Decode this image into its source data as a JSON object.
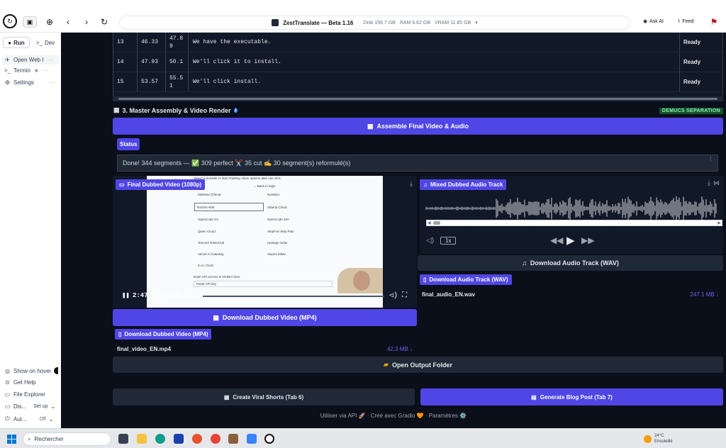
{
  "browser": {
    "title": "ZestTranslate — Beta 1.16",
    "disk": "Disk 156.7 GB",
    "ram": "RAM 5.62 GB",
    "vram": "VRAM 11.85 GB",
    "ask_ai": "Ask AI",
    "feed": "Feed"
  },
  "sidebar": {
    "tabs": [
      {
        "label": "Run"
      },
      {
        "label": "Dev"
      }
    ],
    "items": [
      {
        "label": "Open Web I"
      },
      {
        "label": "Termin"
      },
      {
        "label": "Settings"
      }
    ],
    "bottom": [
      {
        "label": "Show on hover"
      },
      {
        "label": "Get Help"
      },
      {
        "label": "File Explorer"
      },
      {
        "label": "Dis...",
        "value": "Set up"
      },
      {
        "label": "Aut...",
        "value": "Off"
      }
    ]
  },
  "segments": [
    {
      "id": "13",
      "start": "46.33",
      "end": "47.8\n9",
      "text": "We have the executable.",
      "status": "Ready"
    },
    {
      "id": "14",
      "start": "47.93",
      "end": "50.1",
      "text": "We'll click it to install.",
      "status": "Ready"
    },
    {
      "id": "15",
      "start": "53.57",
      "end": "55.5\n1",
      "text": "We'll click install.",
      "status": "Ready"
    }
  ],
  "section3": {
    "title": "3. Master Assembly & Video Render",
    "badge": "DEMUCS SEPARATION",
    "assemble_button": "Assemble Final Video & Audio",
    "status_label": "Status",
    "status_text": "Done! 344 segments — ✅ 309 perfect ✂️ 35 cut ✍️ 30 segment(s) reformulé(s)"
  },
  "video": {
    "label": "Final Dubbed Video (1080p)",
    "time": "2:47 / 24:29",
    "progress": 0.11,
    "download_button": "Download Dubbed Video (MP4)",
    "file_label": "Download Dubbed Video (MP4)",
    "filename": "final_video_EN.mp4",
    "filesize": "42.3 MB ↓",
    "frame": {
      "back": "← Back to login",
      "intro": "Select a provider to start chatting. More options take one click.",
      "options_left": [
        "MiniMax (China)",
        "NVIDIA NIM",
        "OpenCode Go",
        "Qwen Cloud",
        "Tencent TokenHub",
        "Vercel AI Gateway",
        "Z.AI / GLM"
      ],
      "options_right": [
        "NovitaAI",
        "Ollama Cloud",
        "OpenCode Zen",
        "StepFun Step Plan",
        "Upstage Solar",
        "Xiaomi MiMo"
      ],
      "api_label": "Enter API access to NVIDIA here",
      "api_placeholder": "Paste API key"
    }
  },
  "audio": {
    "label": "Mixed Dubbed Audio Track",
    "speed": "1x",
    "download_button": "Download Audio Track (WAV)",
    "file_label": "Download Audio Track (WAV)",
    "filename": "final_audio_EN.wav",
    "filesize": "247.1 MB ↓"
  },
  "actions": {
    "open_folder": "Open Output Folder",
    "viral_shorts": "Create Viral Shorts (Tab 6)",
    "blog_post": "Generate Blog Post (Tab 7)"
  },
  "footer": {
    "api": "Utiliser via API 🚀",
    "gradio": "Créé avec Gradio 🧡",
    "settings": "Paramètres ⚙️"
  },
  "taskbar": {
    "search": "Rechercher",
    "temp": "24°C",
    "weather": "Ensoleillé"
  }
}
